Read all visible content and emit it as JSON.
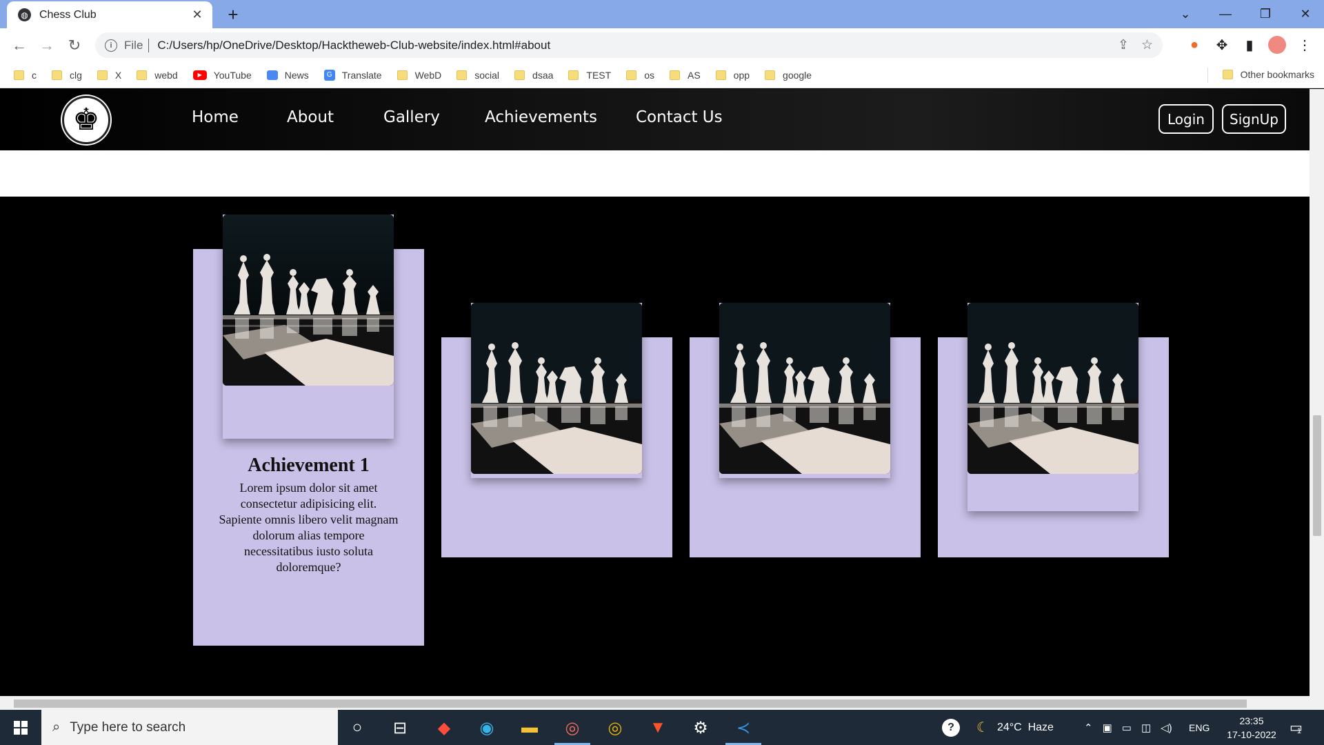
{
  "browser": {
    "tab_title": "Chess Club",
    "url_scheme": "File",
    "url": "C:/Users/hp/OneDrive/Desktop/Hacktheweb-Club-website/index.html#about",
    "bookmarks": [
      "c",
      "clg",
      "X",
      "webd",
      "YouTube",
      "News",
      "Translate",
      "WebD",
      "social",
      "dsaa",
      "TEST",
      "os",
      "AS",
      "opp",
      "google"
    ],
    "other_bookmarks": "Other bookmarks"
  },
  "site": {
    "nav": [
      "Home",
      "About",
      "Gallery",
      "Achievements",
      "Contact Us"
    ],
    "login": "Login",
    "signup": "SignUp",
    "cards": [
      {
        "title": "Achievement 1",
        "text": "Lorem ipsum dolor sit amet consectetur adipisicing elit. Sapiente omnis libero velit magnam dolorum alias tempore necessitatibus iusto soluta doloremque?"
      }
    ]
  },
  "taskbar": {
    "search_placeholder": "Type here to search",
    "weather": "24°C  Haze",
    "language": "ENG",
    "time": "23:35",
    "date": "17-10-2022",
    "notifications": "1"
  },
  "colors": {
    "card": "#c9c1e7",
    "tabbar": "#87a9e8",
    "taskbar": "#1f2a38"
  }
}
